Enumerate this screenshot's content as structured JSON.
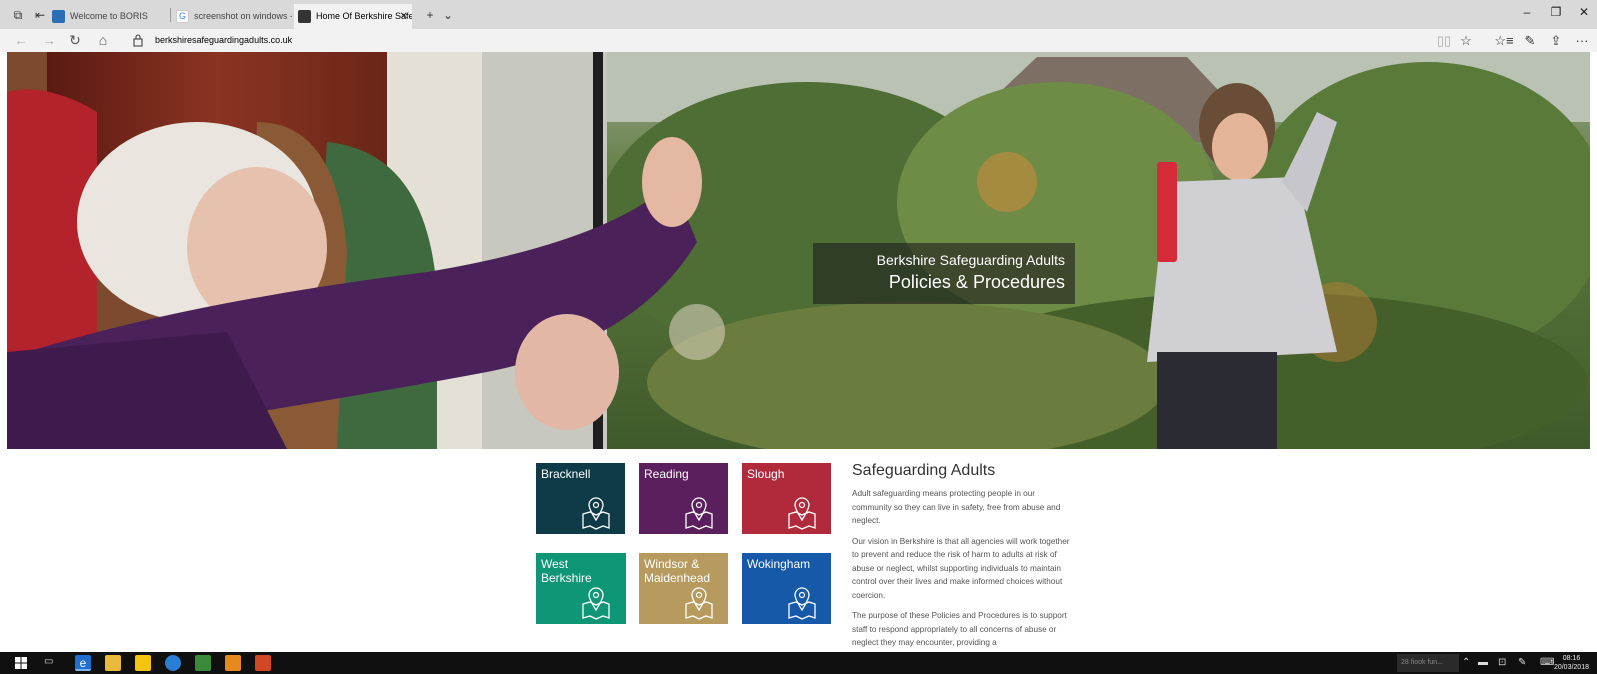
{
  "browser": {
    "tabs": [
      {
        "title": "Welcome to BORIS",
        "active": false
      },
      {
        "title": "screenshot on windows - Go",
        "active": false
      },
      {
        "title": "Home Of Berkshire Safe",
        "active": true
      }
    ],
    "address": "berkshiresafeguardingadults.co.uk"
  },
  "hero": {
    "line1": "Berkshire Safeguarding Adults",
    "line2": "Policies & Procedures"
  },
  "areas": [
    {
      "name": "Bracknell",
      "color": "#0e3b47"
    },
    {
      "name": "Reading",
      "color": "#5a1f5c"
    },
    {
      "name": "Slough",
      "color": "#b02a3c"
    },
    {
      "name": "West Berkshire",
      "color": "#0f9677"
    },
    {
      "name": "Windsor & Maidenhead",
      "color": "#b69a5e"
    },
    {
      "name": "Wokingham",
      "color": "#1559a8"
    }
  ],
  "content": {
    "heading": "Safeguarding Adults",
    "paragraphs": [
      "Adult safeguarding means protecting people in our community so they can live in safety, free from abuse and neglect.",
      "Our vision in Berkshire is that all agencies will work together to prevent and reduce the risk of harm to adults at risk of abuse or neglect, whilst supporting individuals to maintain control over their lives and make informed choices without coercion.",
      "The purpose of these Policies and Procedures is to support staff to respond appropriately to all concerns of abuse or neglect they may encounter, providing a"
    ]
  },
  "taskbar": {
    "notification": "28 fiook fun...",
    "time": "08:16",
    "date": "20/03/2018"
  }
}
